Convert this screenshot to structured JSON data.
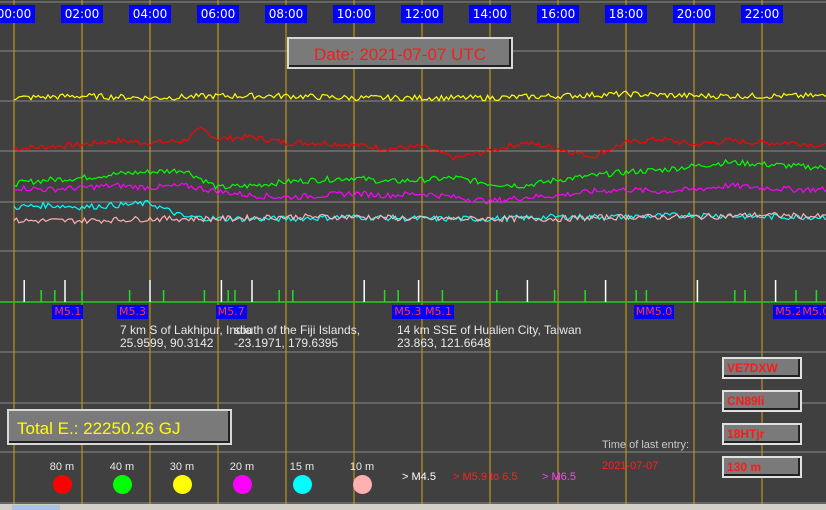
{
  "chart_data": {
    "type": "line",
    "title": "Date: 2021-07-07 UTC",
    "x_tick_labels": [
      "00:00",
      "02:00",
      "04:00",
      "06:00",
      "08:00",
      "10:00",
      "12:00",
      "14:00",
      "16:00",
      "18:00",
      "20:00",
      "22:00"
    ],
    "xlim_hours": [
      0,
      24
    ],
    "grid": true,
    "series": [
      {
        "name": "80 m",
        "color": "#ff0000",
        "x_hours": [
          0,
          1,
          2,
          3,
          4,
          5,
          5.5,
          6,
          7,
          8,
          9,
          10,
          11,
          12,
          13,
          14,
          15,
          16,
          17,
          18,
          19,
          20,
          21,
          22,
          23,
          24
        ],
        "values": [
          0.52,
          0.53,
          0.54,
          0.56,
          0.55,
          0.56,
          0.62,
          0.57,
          0.58,
          0.55,
          0.55,
          0.54,
          0.52,
          0.53,
          0.47,
          0.51,
          0.55,
          0.52,
          0.48,
          0.55,
          0.57,
          0.54,
          0.56,
          0.55,
          0.55,
          0.53
        ]
      },
      {
        "name": "40 m",
        "color": "#00ff00",
        "x_hours": [
          0,
          1,
          2,
          3,
          4,
          5,
          6,
          7,
          8,
          9,
          10,
          11,
          12,
          13,
          14,
          15,
          16,
          17,
          18,
          19,
          20,
          21,
          22,
          23,
          24
        ],
        "values": [
          0.34,
          0.36,
          0.37,
          0.39,
          0.4,
          0.41,
          0.32,
          0.33,
          0.35,
          0.36,
          0.37,
          0.35,
          0.36,
          0.37,
          0.34,
          0.33,
          0.36,
          0.38,
          0.4,
          0.41,
          0.43,
          0.45,
          0.44,
          0.43,
          0.42
        ]
      },
      {
        "name": "30 m",
        "color": "#ffff00",
        "x_hours": [
          0,
          2,
          4,
          6,
          8,
          10,
          12,
          14,
          16,
          18,
          20,
          22,
          24
        ],
        "values": [
          0.78,
          0.79,
          0.78,
          0.79,
          0.79,
          0.78,
          0.78,
          0.78,
          0.79,
          0.8,
          0.79,
          0.79,
          0.79
        ]
      },
      {
        "name": "20 m",
        "color": "#ff00ff",
        "x_hours": [
          0,
          1,
          2,
          3,
          4,
          5,
          6,
          7,
          8,
          9,
          10,
          11,
          12,
          13,
          14,
          15,
          16,
          17,
          18,
          19,
          20,
          21,
          22,
          23,
          24
        ],
        "values": [
          0.32,
          0.31,
          0.32,
          0.33,
          0.32,
          0.33,
          0.3,
          0.28,
          0.27,
          0.28,
          0.29,
          0.28,
          0.29,
          0.27,
          0.25,
          0.27,
          0.28,
          0.3,
          0.31,
          0.3,
          0.31,
          0.33,
          0.32,
          0.31,
          0.31
        ]
      },
      {
        "name": "15 m",
        "color": "#00ffff",
        "x_hours": [
          0,
          1,
          2,
          3,
          4,
          5,
          6,
          8,
          10,
          12,
          14,
          16,
          18,
          20,
          22,
          24
        ],
        "values": [
          0.22,
          0.23,
          0.22,
          0.23,
          0.24,
          0.17,
          0.16,
          0.16,
          0.17,
          0.16,
          0.16,
          0.17,
          0.17,
          0.18,
          0.17,
          0.17
        ]
      },
      {
        "name": "10 m",
        "color": "#ffb0b0",
        "x_hours": [
          0,
          2,
          4,
          6,
          8,
          10,
          12,
          14,
          16,
          18,
          20,
          22,
          24
        ],
        "values": [
          0.15,
          0.15,
          0.16,
          0.16,
          0.17,
          0.17,
          0.16,
          0.16,
          0.16,
          0.17,
          0.17,
          0.18,
          0.17
        ]
      }
    ],
    "quake_marker_hours": [
      0.3,
      0.8,
      1.2,
      1.5,
      2.0,
      3.4,
      4.0,
      4.4,
      5.6,
      6.1,
      6.3,
      6.5,
      7.0,
      7.8,
      8.2,
      10.3,
      10.9,
      11.3,
      11.9,
      12.6,
      14.2,
      15.1,
      15.9,
      16.8,
      17.4,
      18.3,
      18.6,
      20.1,
      21.2,
      21.5,
      22.4,
      23.0,
      23.6
    ]
  },
  "magnitude_labels": [
    {
      "text": "M5.1",
      "hour": 1.6
    },
    {
      "text": "M5.3",
      "hour": 3.5
    },
    {
      "text": "M5.7",
      "hour": 6.4
    },
    {
      "text": "M5.3",
      "hour": 11.6
    },
    {
      "text": "M5.1",
      "hour": 12.5
    },
    {
      "text": "MM5.0",
      "hour": 18.7
    },
    {
      "text": "M5.2",
      "hour": 22.8
    },
    {
      "text": "M5.0",
      "hour": 23.6
    }
  ],
  "quake_info": [
    {
      "place": "7 km S of Lakhipur, India",
      "coords": "25.9599, 90.3142"
    },
    {
      "place": "south of the Fiji Islands,",
      "coords": "-23.1971, 179.6395"
    },
    {
      "place": "14 km SSE of Hualien City, Taiwan",
      "coords": "23.863, 121.6648"
    }
  ],
  "total_energy": "Total E.: 22250.26 GJ",
  "station": {
    "callsign": "VE7DXW",
    "grid_locator": "CN89li",
    "code": "18HTjr",
    "band": "130 m"
  },
  "last_entry": {
    "label": "Time of last entry:",
    "value": "2021-07-07"
  },
  "band_legend": [
    {
      "name": "80 m",
      "color": "#ff0000"
    },
    {
      "name": "40 m",
      "color": "#00ff00"
    },
    {
      "name": "30 m",
      "color": "#ffff00"
    },
    {
      "name": "20 m",
      "color": "#ff00ff"
    },
    {
      "name": "15 m",
      "color": "#00ffff"
    },
    {
      "name": "10 m",
      "color": "#ffb0b0"
    }
  ],
  "magnitude_legend": [
    {
      "text": "> M4.5",
      "color": "#ffffff"
    },
    {
      "text": "> M5.9 to 6.5",
      "color": "#ff2020"
    },
    {
      "text": "> M6.5",
      "color": "#ff40ff"
    }
  ]
}
